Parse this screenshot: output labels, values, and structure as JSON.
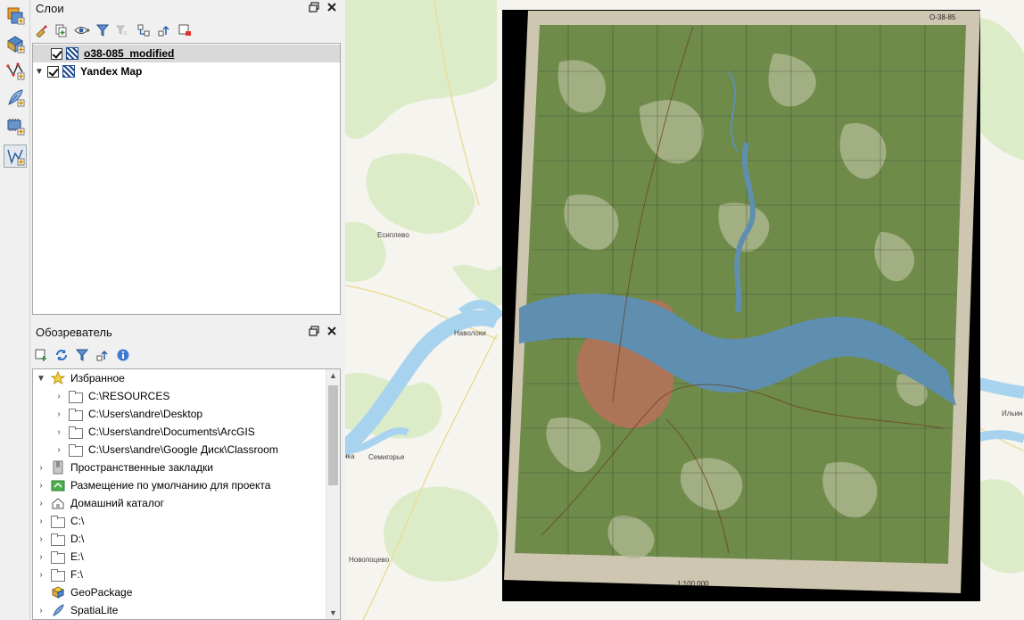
{
  "layers_panel": {
    "title": "Слои",
    "layers": [
      {
        "name": "o38-085_modified",
        "checked": true,
        "selected": true
      },
      {
        "name": "Yandex Map",
        "checked": true,
        "selected": false
      }
    ]
  },
  "browser_panel": {
    "title": "Обозреватель",
    "items": [
      {
        "label": "Избранное",
        "expanded": true,
        "icon": "star-icon"
      },
      {
        "label": "C:\\RESOURCES",
        "icon": "folder-icon"
      },
      {
        "label": "C:\\Users\\andre\\Desktop",
        "icon": "folder-icon"
      },
      {
        "label": "C:\\Users\\andre\\Documents\\ArcGIS",
        "icon": "folder-icon"
      },
      {
        "label": "C:\\Users\\andre\\Google Диск\\Classroom",
        "icon": "folder-icon"
      },
      {
        "label": "Пространственные закладки",
        "icon": "bookmark-icon"
      },
      {
        "label": "Размещение по умолчанию для проекта",
        "icon": "project-home-icon"
      },
      {
        "label": "Домашний каталог",
        "icon": "home-icon"
      },
      {
        "label": "C:\\",
        "icon": "folder-icon"
      },
      {
        "label": "D:\\",
        "icon": "folder-icon"
      },
      {
        "label": "E:\\",
        "icon": "folder-icon"
      },
      {
        "label": "F:\\",
        "icon": "folder-icon"
      },
      {
        "label": "GeoPackage",
        "icon": "geopackage-icon"
      },
      {
        "label": "SpatiaLite",
        "icon": "spatialite-icon"
      }
    ]
  },
  "map": {
    "place_labels": [
      "Есиплево",
      "Наволоки",
      "Семигорье",
      "Новопоцево",
      "Ильин"
    ],
    "scan_scale_text": "1:100 000",
    "scan_sheet_code": "O-38-85"
  },
  "colors": {
    "river": "#a8d3ef",
    "forest": "#dcecc8",
    "scan_green": "#6e8b4a",
    "scan_water": "#5e8fb0",
    "town": "#b8715a"
  }
}
